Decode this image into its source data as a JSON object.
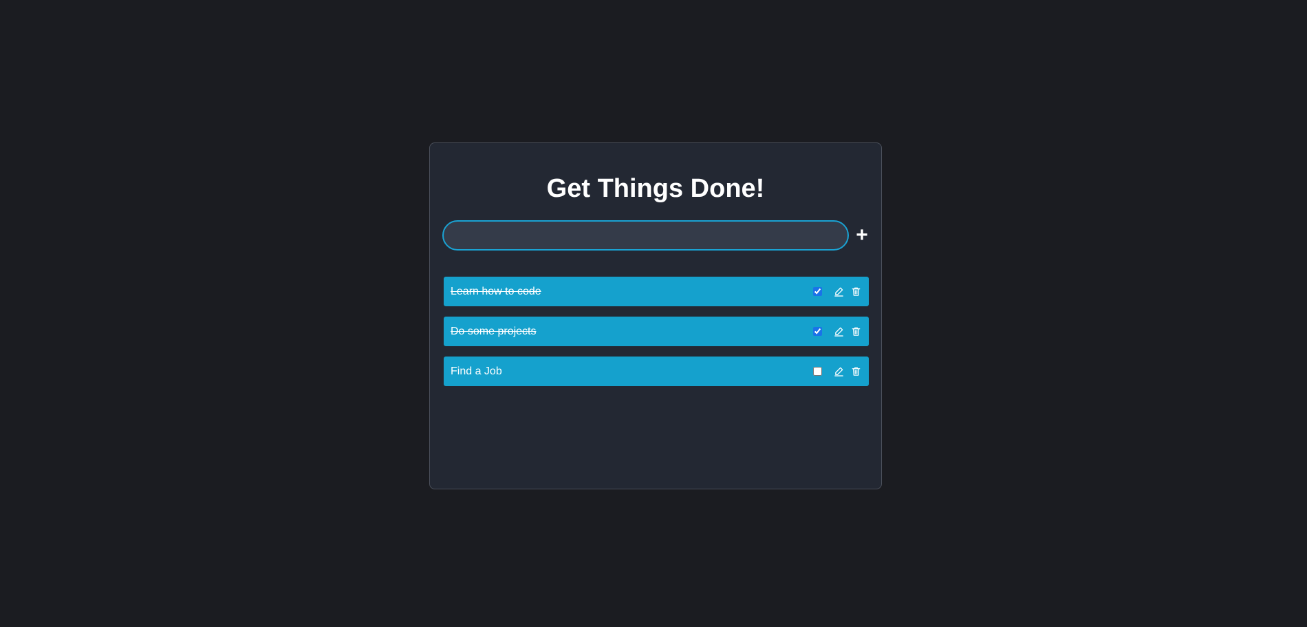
{
  "app": {
    "title": "Get Things Done!"
  },
  "add_form": {
    "input_value": "",
    "input_placeholder": "",
    "add_icon": "plus-icon",
    "add_label": "+"
  },
  "todos": [
    {
      "text": "Learn how to code",
      "completed": true
    },
    {
      "text": "Do some projects",
      "completed": true
    },
    {
      "text": "Find a Job",
      "completed": false
    }
  ],
  "icons": {
    "edit": "pencil-icon",
    "delete": "trash-icon"
  },
  "colors": {
    "background": "#1b1c21",
    "card": "#232833",
    "accent": "#15a1cd",
    "input_bg": "#343b49",
    "text": "#ffffff"
  }
}
